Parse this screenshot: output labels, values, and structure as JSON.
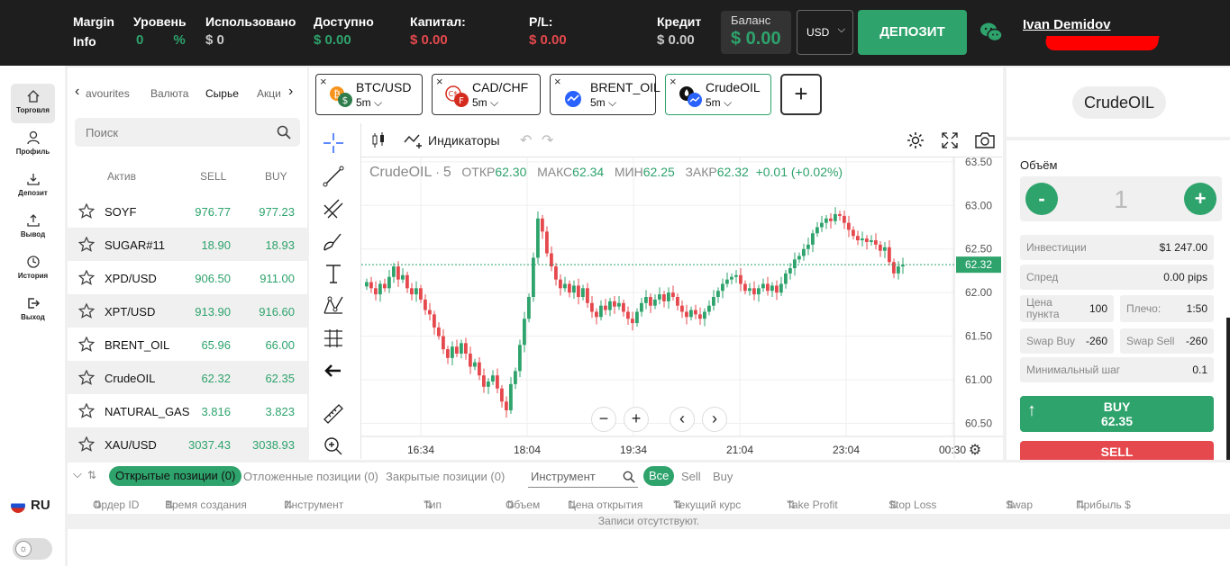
{
  "topbar": {
    "margin_label": "Margin",
    "margin_label2": "Info",
    "level_label": "Уровень",
    "level_value": "0",
    "level_unit": "%",
    "used_label": "Использовано",
    "used_value": "$ 0",
    "available_label": "Доступно",
    "available_value": "$ 0.00",
    "capital_label": "Капитал:",
    "capital_value": "$ 0.00",
    "pl_label": "P/L:",
    "pl_value": "$ 0.00",
    "credit_label": "Кредит",
    "credit_value": "$ 0.00",
    "balance_label": "Баланс",
    "balance_value": "$ 0.00",
    "currency": "USD",
    "deposit_label": "ДЕПОЗИТ",
    "username": "Ivan Demidov",
    "colors": {
      "accent": "#2ea36c",
      "negative": "#e5484d",
      "bar": "#1e1e1e"
    }
  },
  "nav": [
    {
      "label": "Торговля",
      "icon": "home-icon"
    },
    {
      "label": "Профиль",
      "icon": "user-icon"
    },
    {
      "label": "Депозит",
      "icon": "download-icon"
    },
    {
      "label": "Вывод",
      "icon": "upload-icon"
    },
    {
      "label": "История",
      "icon": "clock-icon"
    },
    {
      "label": "Выход",
      "icon": "logout-icon"
    }
  ],
  "language": "RU",
  "assets": {
    "tabs": [
      "avourites",
      "Валюта",
      "Сырье",
      "Акци"
    ],
    "active_tab": "Сырье",
    "search_placeholder": "Поиск",
    "columns": {
      "asset": "Актив",
      "sell": "SELL",
      "buy": "BUY"
    },
    "rows": [
      {
        "name": "SOYF",
        "sell": "976.77",
        "buy": "977.23"
      },
      {
        "name": "SUGAR#11",
        "sell": "18.90",
        "buy": "18.93"
      },
      {
        "name": "XPD/USD",
        "sell": "906.50",
        "buy": "911.00"
      },
      {
        "name": "XPT/USD",
        "sell": "913.90",
        "buy": "916.60"
      },
      {
        "name": "BRENT_OIL",
        "sell": "65.96",
        "buy": "66.00"
      },
      {
        "name": "CrudeOIL",
        "sell": "62.32",
        "buy": "62.35"
      },
      {
        "name": "NATURAL_GAS",
        "sell": "3.816",
        "buy": "3.823"
      },
      {
        "name": "XAU/USD",
        "sell": "3037.43",
        "buy": "3038.93"
      }
    ]
  },
  "chart_tabs": [
    {
      "symbol": "BTC/USD",
      "timeframe": "5m",
      "close": "×"
    },
    {
      "symbol": "CAD/CHF",
      "timeframe": "5m",
      "close": "×"
    },
    {
      "symbol": "BRENT_OIL",
      "timeframe": "5m",
      "close": "×"
    },
    {
      "symbol": "CrudeOIL",
      "timeframe": "5m",
      "close": "×"
    }
  ],
  "chart_toolbar": {
    "indicators_label": "Индикаторы"
  },
  "chart_data": {
    "type": "candlestick",
    "symbol": "CrudeOIL",
    "interval": "5",
    "ohlc_labels": {
      "open": "ОТКР",
      "high": "МАКС",
      "low": "МИН",
      "close": "ЗАКР"
    },
    "ohlc_values": {
      "open": "62.30",
      "high": "62.34",
      "low": "62.25",
      "close": "62.32"
    },
    "change": "+0.01 (+0.02%)",
    "last_price": "62.32",
    "y_ticks": [
      "63.50",
      "63.00",
      "62.50",
      "62.00",
      "61.50",
      "61.00",
      "60.50"
    ],
    "x_ticks": [
      "16:34",
      "18:04",
      "19:34",
      "21:04",
      "23:04",
      "00:30"
    ],
    "ylim": [
      60.35,
      63.55
    ],
    "colors": {
      "up": "#2ea36c",
      "down": "#e5484d"
    },
    "close_series": [
      62.12,
      62.05,
      61.98,
      62.1,
      62.05,
      62.18,
      62.3,
      62.15,
      62.2,
      62.05,
      61.98,
      62.05,
      61.92,
      61.8,
      61.75,
      61.6,
      61.5,
      61.35,
      61.25,
      61.38,
      61.3,
      61.42,
      61.3,
      61.15,
      61.2,
      61.05,
      60.92,
      60.98,
      61.05,
      60.9,
      60.75,
      60.65,
      60.95,
      61.1,
      61.4,
      61.7,
      61.95,
      62.4,
      62.85,
      62.7,
      62.45,
      62.3,
      62.15,
      62.05,
      62.1,
      62.0,
      62.08,
      61.95,
      62.05,
      61.88,
      61.78,
      61.72,
      61.85,
      61.8,
      61.9,
      61.84,
      61.88,
      61.78,
      61.7,
      61.65,
      61.78,
      61.88,
      61.95,
      61.85,
      61.92,
      61.98,
      61.9,
      62.0,
      61.95,
      61.85,
      61.78,
      61.72,
      61.8,
      61.75,
      61.7,
      61.78,
      61.85,
      61.95,
      62.02,
      62.1,
      62.15,
      62.18,
      62.2,
      62.1,
      62.02,
      62.05,
      61.98,
      62.05,
      62.1,
      62.02,
      62.08,
      62.0,
      62.1,
      62.22,
      62.28,
      62.38,
      62.42,
      62.5,
      62.55,
      62.68,
      62.75,
      62.8,
      62.85,
      62.82,
      62.9,
      62.88,
      62.8,
      62.72,
      62.65,
      62.6,
      62.62,
      62.58,
      62.6,
      62.55,
      62.48,
      62.52,
      62.35,
      62.22,
      62.3,
      62.32
    ]
  },
  "order": {
    "instrument": "CrudeOIL",
    "volume_label": "Объём",
    "volume": "1",
    "minus": "-",
    "plus": "+",
    "investment_label": "Инвестиции",
    "investment_value": "$1 247.00",
    "spread_label": "Спред",
    "spread_value": "0.00 pips",
    "point_price_label": "Цена пункта",
    "point_price_value": "100",
    "leverage_label": "Плечо:",
    "leverage_value": "1:50",
    "swap_buy_label": "Swap Buy",
    "swap_buy_value": "-260",
    "swap_sell_label": "Swap Sell",
    "swap_sell_value": "-260",
    "min_step_label": "Минимальный шаг",
    "min_step_value": "0.1",
    "buy_label": "BUY",
    "buy_price": "62.35",
    "sell_label": "SELL"
  },
  "positions": {
    "tabs": [
      "Открытые позиции (0)",
      "Отложенные позиции (0)",
      "Закрытые позиции (0)"
    ],
    "instrument_placeholder": "Инструмент",
    "filters": [
      "Все",
      "Sell",
      "Buy"
    ],
    "columns": [
      "Ордер ID",
      "Время создания",
      "Инструмент",
      "Тип",
      "Объем",
      "Цена открытия",
      "Текущий курс",
      "Take Profit",
      "Stop Loss",
      "Swap",
      "Прибыль $"
    ],
    "empty_text": "Записи отсутствуют."
  }
}
